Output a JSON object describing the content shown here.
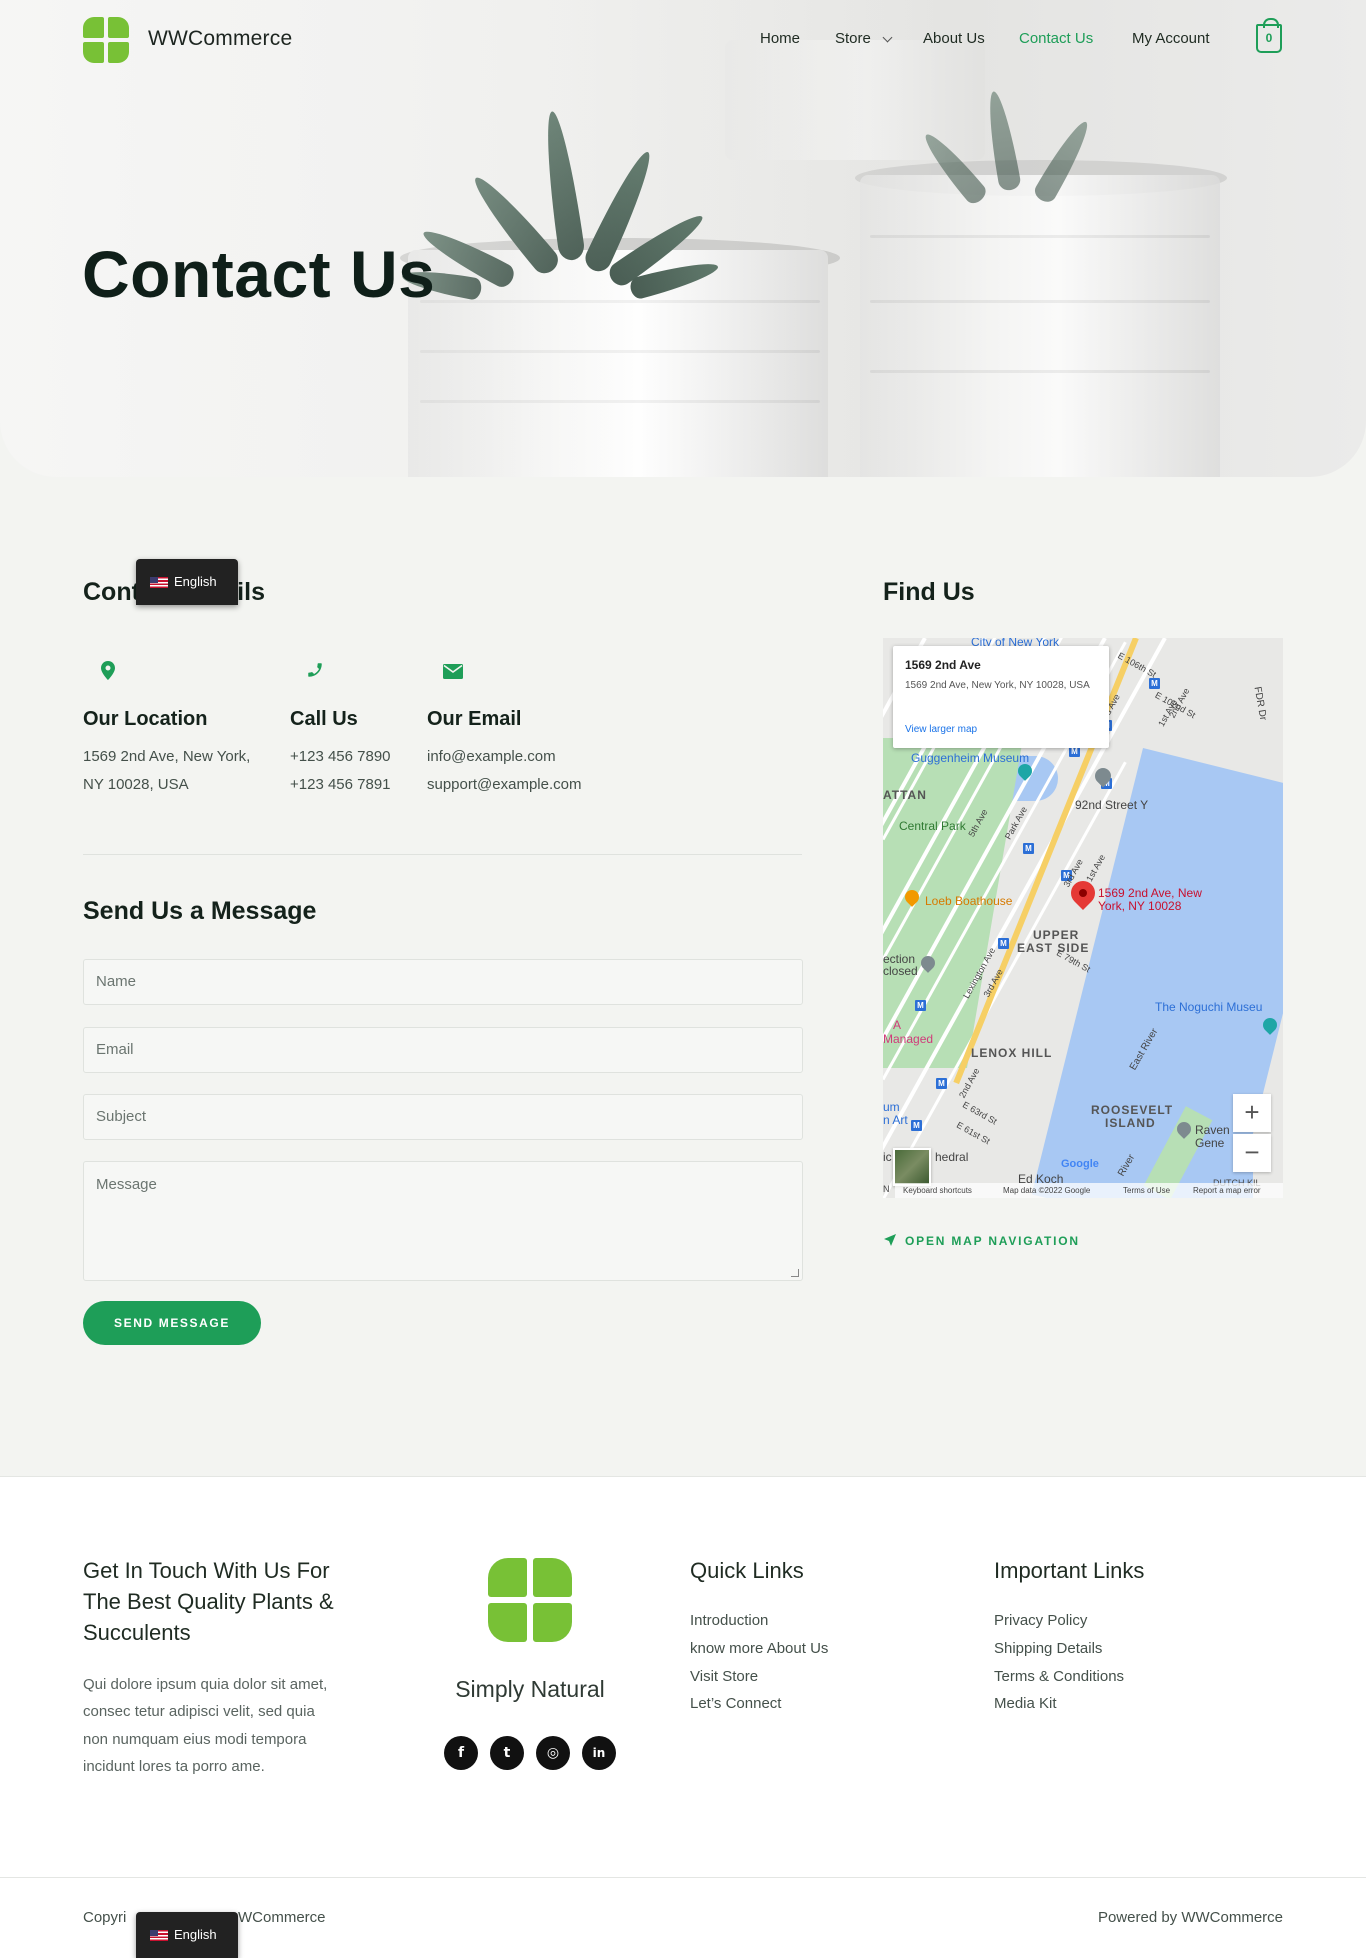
{
  "header": {
    "brand": "WWCommerce",
    "nav": [
      {
        "label": "Home"
      },
      {
        "label": "Store"
      },
      {
        "label": "About Us"
      },
      {
        "label": "Contact Us"
      },
      {
        "label": "My Account"
      }
    ],
    "cart_count": "0",
    "active_nav": "Contact Us"
  },
  "hero": {
    "title": "Contact Us"
  },
  "contact_details": {
    "heading": "Contact Details",
    "columns": [
      {
        "icon": "map-pin-icon",
        "title": "Our Location",
        "lines": [
          "1569 2nd Ave, New York,",
          "NY 10028, USA"
        ]
      },
      {
        "icon": "phone-icon",
        "title": "Call Us",
        "lines": [
          "+123 456 7890",
          "+123 456 7891"
        ]
      },
      {
        "icon": "envelope-icon",
        "title": "Our Email",
        "lines": [
          "info@example.com",
          "support@example.com"
        ]
      }
    ]
  },
  "form": {
    "heading": "Send Us a Message",
    "name_placeholder": "Name",
    "email_placeholder": "Email",
    "subject_placeholder": "Subject",
    "message_placeholder": "Message",
    "submit_label": "SEND MESSAGE"
  },
  "map": {
    "heading": "Find Us",
    "info_title": "1569 2nd Ave",
    "info_address": "1569 2nd Ave, New York, NY 10028, USA",
    "info_link": "View larger map",
    "pin_label": "1569 2nd Ave, New York, NY 10028",
    "labels": {
      "city": "City of New York",
      "guggenheim": "Guggenheim Museum",
      "attan": "ATTAN",
      "central_park": "Central Park",
      "street92": "92nd Street Y",
      "boathouse": "Loeb Boathouse",
      "upper": "UPPER",
      "east_side": "EAST SIDE",
      "lenox": "LENOX HILL",
      "roosevelt": "ROOSEVELT",
      "island": "ISLAND",
      "noguchi": "The Noguchi Museu",
      "a_managed": "A",
      "managed": "Managed",
      "ection": "ection",
      "closed": "closed",
      "um": "um",
      "art": "n Art",
      "cathedral": "hedral",
      "ed_koch": "Ed Koch",
      "ravens": "Raven",
      "gene": "Gene",
      "fdr": "FDR Dr",
      "east_river": "East River",
      "e106": "E 106th St",
      "e102": "E 102nd St",
      "e79": "E 79th St",
      "e63": "E 63rd St",
      "e61": "E 61st St",
      "st5": "5th Ave",
      "park": "Park Ave",
      "first": "1st Ave",
      "third": "3rd Ave",
      "lex": "Lexington Ave",
      "third2": "3rd Ave",
      "second2": "2nd Ave",
      "first_ave": "1st Ave",
      "third_ave": "3rd Ave",
      "second_ave": "2nd Ave",
      "google": "Google",
      "river": "River",
      "dutch": "DUTCH KIL",
      "n": "N",
      "ic": "ic"
    },
    "footer": {
      "shortcuts": "Keyboard shortcuts",
      "data": "Map data ©2022 Google",
      "terms": "Terms of Use",
      "report": "Report a map error"
    },
    "open_nav": "OPEN MAP NAVIGATION"
  },
  "footer": {
    "tagline": [
      "Get In Touch With Us For",
      "The Best Quality Plants &",
      "Succulents"
    ],
    "description": [
      "Qui dolore ipsum quia dolor sit amet,",
      "consec tetur adipisci velit, sed quia",
      "non numquam eius modi tempora",
      "incidunt lores ta porro ame."
    ],
    "logo_caption": "Simply Natural",
    "social": [
      {
        "icon": "facebook-icon",
        "glyph": "f"
      },
      {
        "icon": "twitter-icon",
        "glyph": "t"
      },
      {
        "icon": "instagram-icon",
        "glyph": "◎"
      },
      {
        "icon": "linkedin-icon",
        "glyph": "in"
      }
    ],
    "quick_links": {
      "heading": "Quick Links",
      "items": [
        "Introduction",
        "know more About Us",
        "Visit Store",
        "Let’s Connect"
      ]
    },
    "important_links": {
      "heading": "Important Links",
      "items": [
        "Privacy Policy",
        "Shipping Details",
        "Terms & Conditions",
        "Media Kit"
      ]
    },
    "copyright_start": "Copyri",
    "copyright_end": "WCommerce",
    "powered": "Powered by WWCommerce"
  },
  "language": {
    "label": "English"
  },
  "colors": {
    "accent": "#1e9e58",
    "logo": "#78c136",
    "background": "#f3f4f1"
  }
}
